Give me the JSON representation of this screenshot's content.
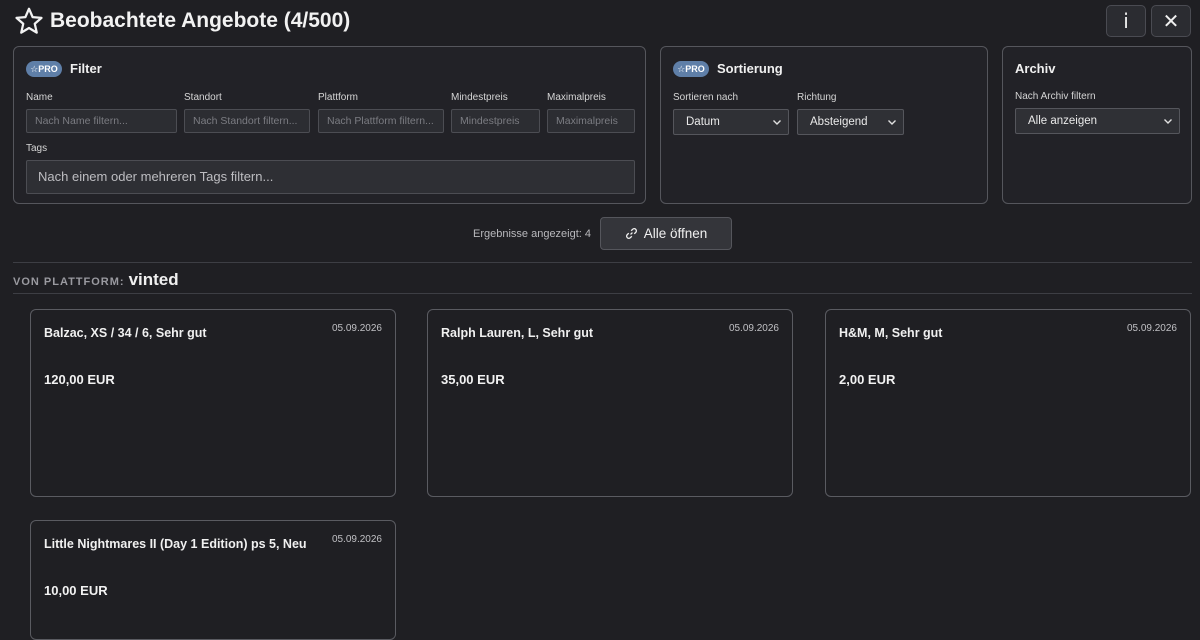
{
  "header": {
    "title": "Beobachtete Angebote (4/500)",
    "info_label": "i",
    "close_label": "✕"
  },
  "filter": {
    "pro_badge": "☆PRO",
    "title": "Filter",
    "name_label": "Name",
    "name_placeholder": "Nach Name filtern...",
    "location_label": "Standort",
    "location_placeholder": "Nach Standort filtern...",
    "platform_label": "Plattform",
    "platform_placeholder": "Nach Plattform filtern...",
    "min_label": "Mindestpreis",
    "min_placeholder": "Mindestpreis",
    "max_label": "Maximalpreis",
    "max_placeholder": "Maximalpreis",
    "tags_label": "Tags",
    "tags_placeholder": "Nach einem oder mehreren Tags filtern..."
  },
  "sort": {
    "pro_badge": "☆PRO",
    "title": "Sortierung",
    "by_label": "Sortieren nach",
    "by_value": "Datum",
    "direction_label": "Richtung",
    "direction_value": "Absteigend"
  },
  "archive": {
    "title": "Archiv",
    "filter_label": "Nach Archiv filtern",
    "filter_value": "Alle anzeigen"
  },
  "results": {
    "count_text": "Ergebnisse angezeigt: 4",
    "open_all_label": "Alle öffnen"
  },
  "platform_group": {
    "prefix": "VON PLATTFORM:",
    "name": "vinted"
  },
  "cards": [
    {
      "title": "Balzac, XS / 34 / 6, Sehr gut",
      "date": "05.09.2026",
      "price": "120,00 EUR"
    },
    {
      "title": "Ralph Lauren, L, Sehr gut",
      "date": "05.09.2026",
      "price": "35,00 EUR"
    },
    {
      "title": "H&M, M, Sehr gut",
      "date": "05.09.2026",
      "price": "2,00 EUR"
    },
    {
      "title": "Little Nightmares II (Day 1 Edition) ps 5, Neu",
      "date": "05.09.2026",
      "price": "10,00 EUR"
    }
  ],
  "icons": {
    "title": "star-outline-icon",
    "open_all": "link-icon",
    "select": "chevron-down-icon"
  }
}
